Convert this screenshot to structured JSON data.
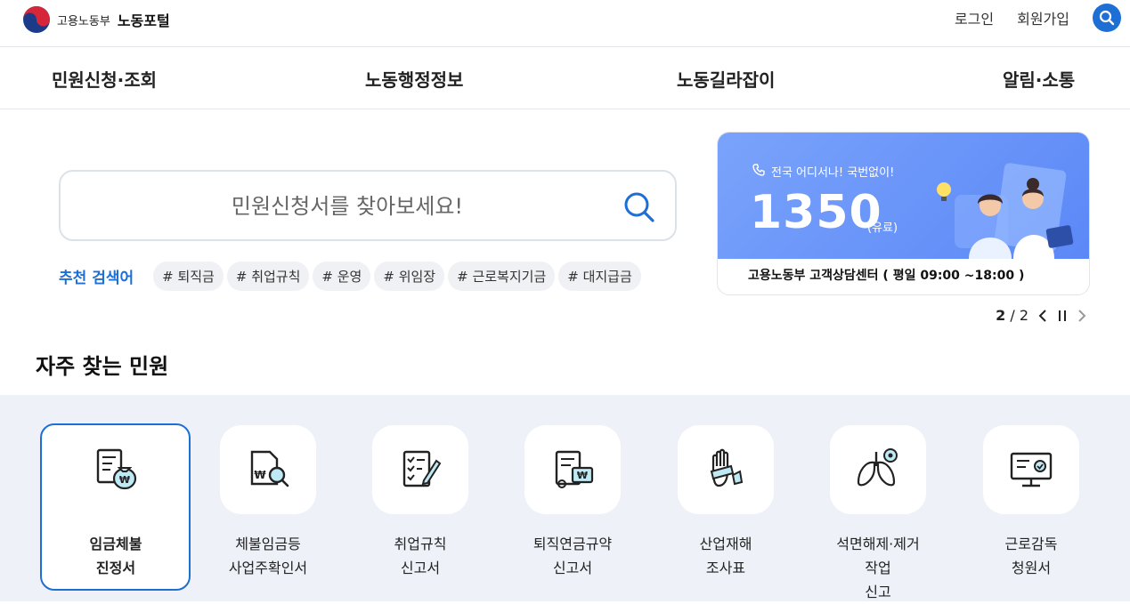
{
  "header": {
    "org_name": "고용노동부",
    "portal_name": "노동포털",
    "login": "로그인",
    "signup": "회원가입"
  },
  "nav": [
    "민원신청·조회",
    "노동행정정보",
    "노동길라잡이",
    "알림·소통"
  ],
  "search": {
    "placeholder": "민원신청서를 찾아보세요!",
    "recommend_label": "추천 검색어",
    "tags": [
      "# 퇴직금",
      "# 취업규칙",
      "# 운영",
      "# 위임장",
      "# 근로복지기금",
      "# 대지급금"
    ]
  },
  "banner": {
    "tagline": "전국 어디서나! 국번없이!",
    "number": "1350",
    "paid_label": "(유료)",
    "caption": "고용노동부 고객상담센터  ( 평일 09:00 ~18:00 )"
  },
  "pager": {
    "current": "2",
    "separator": "/",
    "total": "2"
  },
  "frequent": {
    "title": "자주 찾는 민원",
    "items": [
      {
        "line1": "임금체불",
        "line2": "진정서"
      },
      {
        "line1": "체불임금등",
        "line2": "사업주확인서"
      },
      {
        "line1": "취업규칙",
        "line2": "신고서"
      },
      {
        "line1": "퇴직연금규약",
        "line2": "신고서"
      },
      {
        "line1": "산업재해",
        "line2": "조사표"
      },
      {
        "line1": "석면해제·제거작업",
        "line2": "신고"
      },
      {
        "line1": "근로감독",
        "line2": "청원서"
      }
    ]
  },
  "colors": {
    "accent": "#1d6fd6",
    "banner_blue": "#6a95f9",
    "section_bg": "#eef2f8"
  }
}
